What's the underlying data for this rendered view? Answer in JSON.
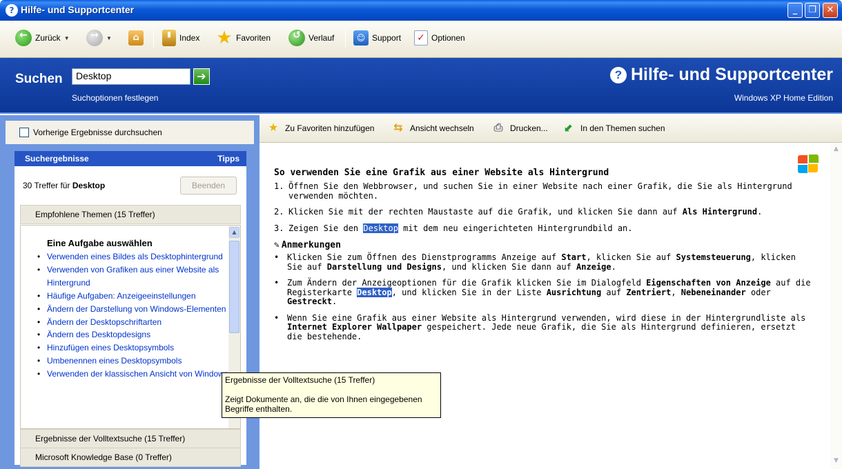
{
  "window": {
    "title": "Hilfe- und Supportcenter",
    "title_icon": "help-icon"
  },
  "window_controls": {
    "minimize": "_",
    "maximize": "❐",
    "close": "✕"
  },
  "toolbar": {
    "back": "Zurück",
    "forward_icon": "forward-icon",
    "home_icon": "home-icon",
    "index": "Index",
    "favorites": "Favoriten",
    "history": "Verlauf",
    "support": "Support",
    "options": "Optionen"
  },
  "search": {
    "label": "Suchen",
    "value": "Desktop",
    "options_link": "Suchoptionen festlegen"
  },
  "brand": {
    "title": "Hilfe- und Supportcenter",
    "edition": "Windows XP Home Edition"
  },
  "left_pane": {
    "search_previous_label": "Vorherige Ergebnisse durchsuchen",
    "search_previous_checked": false,
    "results_title": "Suchergebnisse",
    "tips": "Tipps",
    "count_prefix": "30 Treffer für ",
    "count_term": "Desktop",
    "stop_button": "Beenden",
    "recommended_header": "Empfohlene Themen (15 Treffer)",
    "task_heading": "Eine Aufgabe auswählen",
    "topics": [
      "Verwenden eines Bildes als Desktophintergrund",
      "Verwenden von Grafiken aus einer Website als Hintergrund",
      "Häufige Aufgaben: Anzeigeeinstellungen",
      "Ändern der Darstellung von Windows-Elementen",
      "Ändern der Desktopschriftarten",
      "Ändern des Desktopdesigns",
      "Hinzufügen eines Desktopsymbols",
      "Umbenennen eines Desktopsymbols",
      "Verwenden der klassischen Ansicht von Windows"
    ],
    "fulltext_header": "Ergebnisse der Volltextsuche (15 Treffer)",
    "kb_header": "Microsoft Knowledge Base (0 Treffer)"
  },
  "content_toolbar": {
    "add_favorites": "Zu Favoriten hinzufügen",
    "change_view": "Ansicht wechseln",
    "print": "Drucken...",
    "locate": "In den Themen suchen"
  },
  "article": {
    "title": "So verwenden Sie eine Grafik aus einer Website als Hintergrund",
    "steps": [
      {
        "num": "1.",
        "text": "Öffnen Sie den Webbrowser, und suchen Sie in einer Website nach einer Grafik, die Sie als Hintergrund verwenden möchten."
      },
      {
        "num": "2.",
        "text": "Klicken Sie mit der rechten Maustaste auf die Grafik, und klicken Sie dann auf ",
        "bold": "Als Hintergrund",
        "end": "."
      },
      {
        "num": "3.",
        "pre": "Zeigen Sie den ",
        "highlight": "Desktop",
        "post": " mit dem neu eingerichteten Hintergrundbild an."
      }
    ],
    "notes_heading": "Anmerkungen",
    "note1": {
      "a": "Klicken Sie zum Öffnen des Dienstprogramms Anzeige auf ",
      "b1": "Start",
      "c": ", klicken Sie auf ",
      "b2": "Systemsteuerung",
      "d": ", klicken Sie auf ",
      "b3": "Darstellung und Designs",
      "e": ", und klicken Sie dann auf ",
      "b4": "Anzeige",
      "f": "."
    },
    "note2": {
      "a": "Zum Ändern der Anzeigeoptionen für die Grafik klicken Sie im Dialogfeld ",
      "b1": "Eigenschaften von Anzeige",
      "c": " auf die Registerkarte ",
      "hl": "Desktop",
      "d": ", und klicken Sie in der Liste ",
      "b2": "Ausrichtung",
      "e": " auf ",
      "b3": "Zentriert",
      "f": ", ",
      "b4": "Nebeneinander",
      "g": " oder ",
      "b5": "Gestreckt",
      "h": "."
    },
    "note3": {
      "a": "Wenn Sie eine Grafik aus einer Website als Hintergrund verwenden, wird diese in der Hintergrundliste als ",
      "b1": "Internet Explorer Wallpaper",
      "c": " gespeichert. Jede neue Grafik, die Sie als Hintergrund definieren, ersetzt die bestehende."
    }
  },
  "tooltip": {
    "title": "Ergebnisse der Volltextsuche (15 Treffer)",
    "body": "Zeigt Dokumente an, die die von Ihnen eingegebenen Begriffe enthalten."
  },
  "colors": {
    "header_blue": "#0c3798",
    "panel_blue": "#6e97e0",
    "results_head": "#2754c4",
    "link": "#0033cc",
    "highlight": "#2e60c8"
  }
}
